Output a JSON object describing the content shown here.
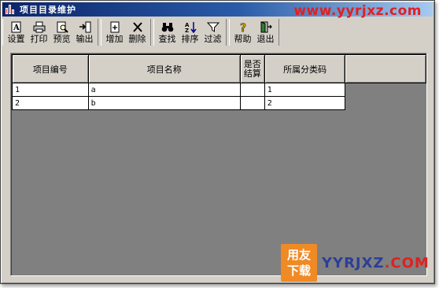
{
  "window": {
    "title": "项目目录维护"
  },
  "watermark": {
    "top": "www.yyrjxz.com",
    "badge_line1": "用友",
    "badge_line2": "下载",
    "bottom_main": "YYRJXZ",
    "bottom_suffix": ".COM"
  },
  "toolbar": {
    "groups": [
      [
        {
          "label": "设置",
          "icon": "setup-icon"
        },
        {
          "label": "打印",
          "icon": "printer-icon"
        },
        {
          "label": "预览",
          "icon": "preview-icon"
        },
        {
          "label": "输出",
          "icon": "export-icon"
        }
      ],
      [
        {
          "label": "增加",
          "icon": "add-icon"
        },
        {
          "label": "删除",
          "icon": "delete-icon"
        }
      ],
      [
        {
          "label": "查找",
          "icon": "binoculars-icon"
        },
        {
          "label": "排序",
          "icon": "sort-icon"
        },
        {
          "label": "过滤",
          "icon": "filter-icon"
        }
      ],
      [
        {
          "label": "帮助",
          "icon": "help-icon"
        },
        {
          "label": "退出",
          "icon": "exit-icon"
        }
      ]
    ]
  },
  "grid": {
    "columns": [
      "项目编号",
      "项目名称",
      "是否结算",
      "所属分类码"
    ],
    "rows": [
      [
        "1",
        "a",
        "",
        "1"
      ],
      [
        "2",
        "b",
        "",
        "2"
      ]
    ]
  }
}
